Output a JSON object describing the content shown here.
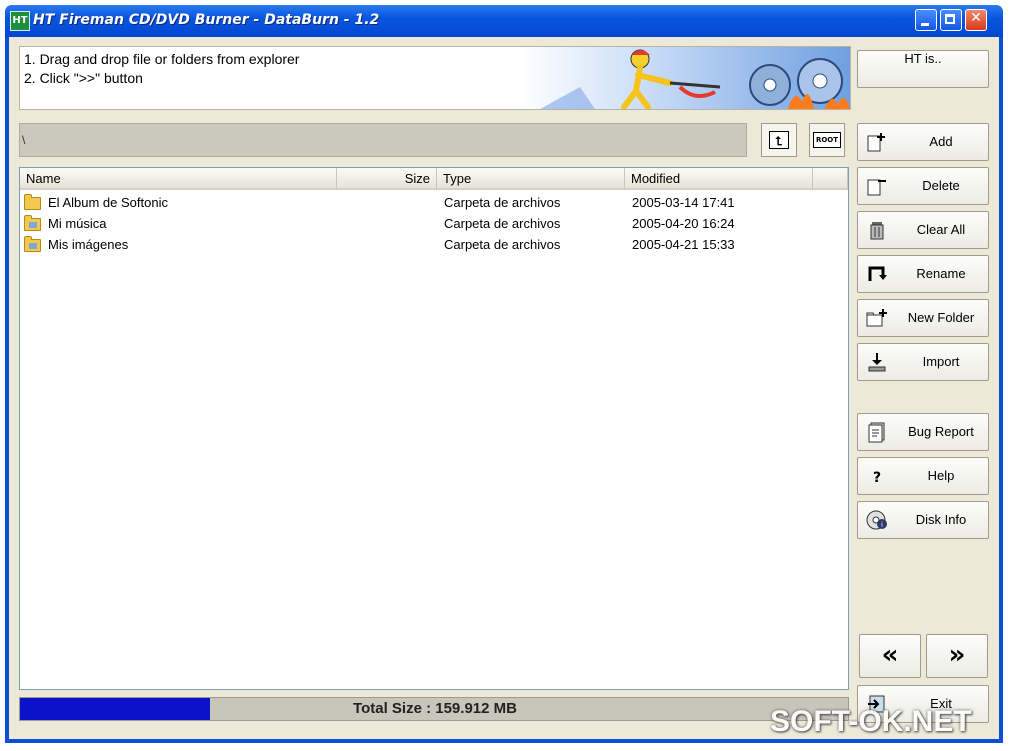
{
  "window": {
    "title": "HT Fireman CD/DVD Burner - DataBurn - 1.2",
    "app_icon_text": "HT",
    "controls": [
      "minimize",
      "maximize",
      "close"
    ]
  },
  "instructions": {
    "line1": "1. Drag and drop file or folders from explorer",
    "line2": "2. Click \">>\" button"
  },
  "ht_button": {
    "label": "HT is.."
  },
  "path_bar": {
    "path": "\\",
    "up_icon": "folder-up-icon",
    "root_label": "ROOT"
  },
  "file_list": {
    "columns": {
      "name": "Name",
      "size": "Size",
      "type": "Type",
      "modified": "Modified"
    },
    "rows": [
      {
        "name": "El Album de Softonic",
        "size": "",
        "type": "Carpeta de archivos",
        "modified": "2005-03-14 17:41",
        "icon": "folder-icon"
      },
      {
        "name": "Mi música",
        "size": "",
        "type": "Carpeta de archivos",
        "modified": "2005-04-20 16:24",
        "icon": "music-folder-icon"
      },
      {
        "name": "Mis imágenes",
        "size": "",
        "type": "Carpeta de archivos",
        "modified": "2005-04-21 15:33",
        "icon": "pictures-folder-icon"
      }
    ]
  },
  "sidebar": {
    "add": "Add",
    "delete": "Delete",
    "clear_all": "Clear All",
    "rename": "Rename",
    "new_folder": "New Folder",
    "import": "Import",
    "bug_report": "Bug Report",
    "help": "Help",
    "disk_info": "Disk Info",
    "back": "«",
    "next": "»",
    "exit": "Exit"
  },
  "status": {
    "total_size": "Total Size : 159.912 MB",
    "progress_fraction": 0.23
  },
  "watermark": "SOFT-OK.NET",
  "colors": {
    "titlebar": "#0a56e0",
    "progress": "#0b12c8",
    "face": "#ece9d8"
  }
}
